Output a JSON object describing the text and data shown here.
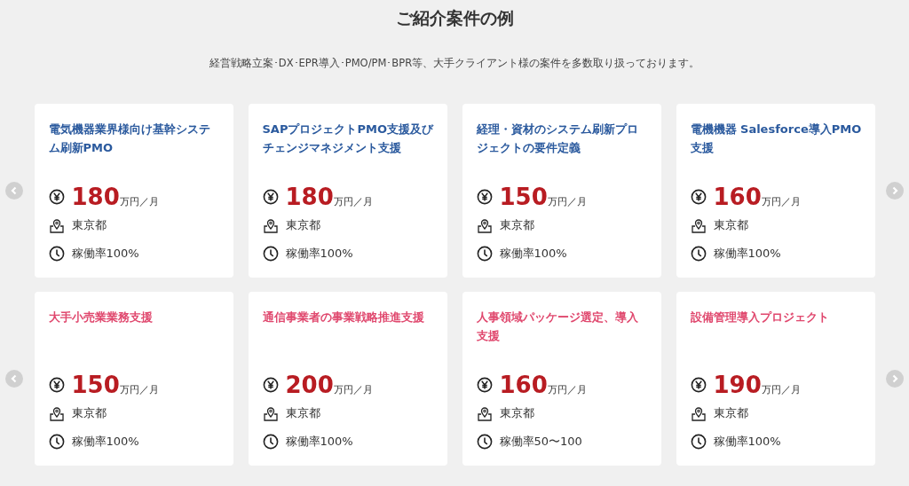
{
  "heading": "ご紹介案件の例",
  "lead": "経営戦略立案･DX･EPR導入･PMO/PM･BPR等、大手クライアント様の案件を多数取り扱っております。",
  "carousels": [
    {
      "color": "#2b5a9e",
      "cards": [
        {
          "title": "電気機器業界様向け基幹システム刷新PMO",
          "price": "180",
          "unit": "万円／月",
          "location": "東京都",
          "utilization": "稼働率100%"
        },
        {
          "title": "SAPプロジェクトPMO支援及びチェンジマネジメント支援",
          "price": "180",
          "unit": "万円／月",
          "location": "東京都",
          "utilization": "稼働率100%"
        },
        {
          "title": "経理・資材のシステム刷新プロジェクトの要件定義",
          "price": "150",
          "unit": "万円／月",
          "location": "東京都",
          "utilization": "稼働率100%"
        },
        {
          "title": "電機機器 Salesforce導入PMO支援",
          "price": "160",
          "unit": "万円／月",
          "location": "東京都",
          "utilization": "稼働率100%"
        }
      ]
    },
    {
      "color": "#e0486e",
      "cards": [
        {
          "title": "大手小売業業務支援",
          "price": "150",
          "unit": "万円／月",
          "location": "東京都",
          "utilization": "稼働率100%"
        },
        {
          "title": "通信事業者の事業戦略推進支援",
          "price": "200",
          "unit": "万円／月",
          "location": "東京都",
          "utilization": "稼働率100%"
        },
        {
          "title": "人事領域パッケージ選定、導入支援",
          "price": "160",
          "unit": "万円／月",
          "location": "東京都",
          "utilization": "稼働率50〜100"
        },
        {
          "title": "設備管理導入プロジェクト",
          "price": "190",
          "unit": "万円／月",
          "location": "東京都",
          "utilization": "稼働率100%"
        }
      ]
    }
  ]
}
